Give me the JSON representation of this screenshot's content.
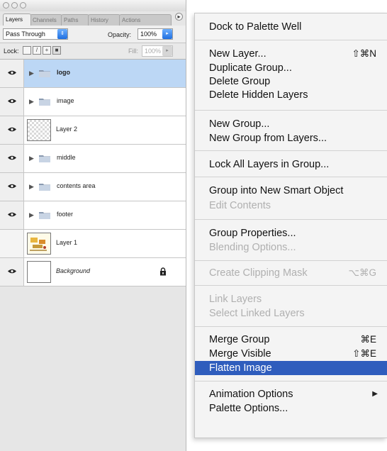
{
  "palette": {
    "tabs": [
      "Layers",
      "Channels",
      "Paths",
      "History",
      "Actions"
    ],
    "blend_mode": "Pass Through",
    "opacity_label": "Opacity:",
    "opacity_value": "100%",
    "lock_label": "Lock:",
    "fill_label": "Fill:",
    "fill_value": "100%",
    "layers": [
      {
        "name": "logo",
        "type": "group",
        "visible": true,
        "selected": true
      },
      {
        "name": "image",
        "type": "group",
        "visible": true,
        "selected": false
      },
      {
        "name": "Layer 2",
        "type": "layer",
        "visible": true,
        "selected": false
      },
      {
        "name": "middle",
        "type": "group",
        "visible": true,
        "selected": false
      },
      {
        "name": "contents area",
        "type": "group",
        "visible": true,
        "selected": false
      },
      {
        "name": "footer",
        "type": "group",
        "visible": true,
        "selected": false
      },
      {
        "name": "Layer 1",
        "type": "layer",
        "visible": false,
        "selected": false
      },
      {
        "name": "Background",
        "type": "background",
        "visible": true,
        "selected": false,
        "locked": true
      }
    ]
  },
  "menu": {
    "items": {
      "dock": {
        "label": "Dock to Palette Well"
      },
      "new_layer": {
        "label": "New Layer...",
        "shortcut": "⇧⌘N"
      },
      "duplicate_group": {
        "label": "Duplicate Group..."
      },
      "delete_group": {
        "label": "Delete Group"
      },
      "delete_hidden": {
        "label": "Delete Hidden Layers"
      },
      "new_group": {
        "label": "New Group..."
      },
      "new_group_from_layers": {
        "label": "New Group from Layers..."
      },
      "lock_all": {
        "label": "Lock All Layers in Group..."
      },
      "group_smart": {
        "label": "Group into New Smart Object"
      },
      "edit_contents": {
        "label": "Edit Contents"
      },
      "group_props": {
        "label": "Group Properties..."
      },
      "blending": {
        "label": "Blending Options..."
      },
      "clipping": {
        "label": "Create Clipping Mask",
        "shortcut": "⌥⌘G"
      },
      "link_layers": {
        "label": "Link Layers"
      },
      "select_linked": {
        "label": "Select Linked Layers"
      },
      "merge_group": {
        "label": "Merge Group",
        "shortcut": "⌘E"
      },
      "merge_visible": {
        "label": "Merge Visible",
        "shortcut": "⇧⌘E"
      },
      "flatten": {
        "label": "Flatten Image"
      },
      "animation": {
        "label": "Animation Options"
      },
      "palette_opts": {
        "label": "Palette Options..."
      }
    }
  },
  "colors": {
    "highlight": "#2f5dbd",
    "selected_layer": "#bcd7f5",
    "stepper": "#1f6fe0"
  }
}
